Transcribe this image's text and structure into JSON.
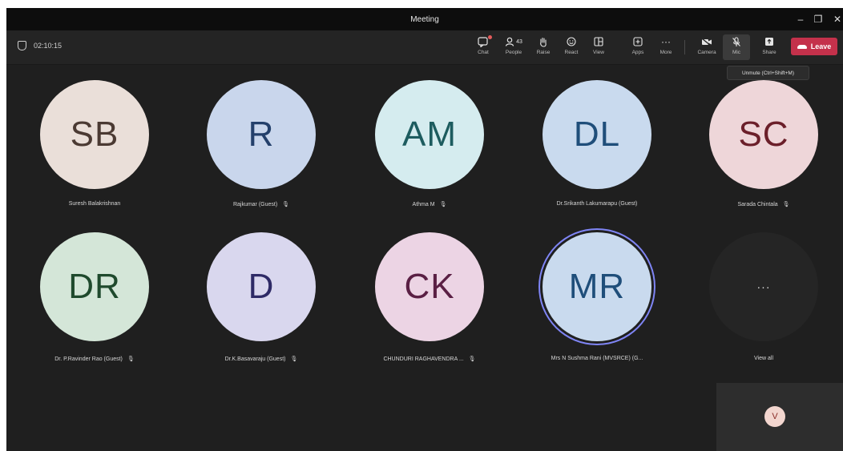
{
  "window": {
    "title": "Meeting",
    "controls": [
      "–",
      "❐",
      "✕"
    ]
  },
  "toolbar": {
    "timer": "02:10:15",
    "buttons": [
      {
        "label": "Chat",
        "icon": "chat-icon"
      },
      {
        "label": "People",
        "icon": "people-icon",
        "count": "43"
      },
      {
        "label": "Raise",
        "icon": "raise-hand-icon"
      },
      {
        "label": "React",
        "icon": "react-icon"
      },
      {
        "label": "View",
        "icon": "view-icon"
      },
      {
        "label": "Apps",
        "icon": "apps-icon"
      },
      {
        "label": "More",
        "icon": "more-icon"
      },
      {
        "label": "Camera",
        "icon": "camera-off-icon"
      },
      {
        "label": "Mic",
        "icon": "mic-off-icon"
      },
      {
        "label": "Share",
        "icon": "share-icon"
      }
    ],
    "leave_label": "Leave",
    "tooltip": "Unmute (Ctrl+Shift+M)"
  },
  "participants": [
    {
      "initials": "SB",
      "name": "Suresh Balakrishnan",
      "muted": false,
      "bg": "#eadfd9",
      "fg": "#4b3a33"
    },
    {
      "initials": "R",
      "name": "Rajkumar (Guest)",
      "muted": true,
      "bg": "#c9d6ec",
      "fg": "#24406b"
    },
    {
      "initials": "AM",
      "name": "Athma M",
      "muted": true,
      "bg": "#d5ecef",
      "fg": "#1d5c5f"
    },
    {
      "initials": "DL",
      "name": "Dr.Srikanth Lakumarapu (Guest)",
      "muted": false,
      "bg": "#c9daee",
      "fg": "#1f4e7a"
    },
    {
      "initials": "SC",
      "name": "Sarada Chintala",
      "muted": true,
      "bg": "#eed6d9",
      "fg": "#6b1f2a"
    },
    {
      "initials": "DR",
      "name": "Dr. P.Ravinder Rao (Guest)",
      "muted": true,
      "bg": "#d4e6d8",
      "fg": "#1f4a2d"
    },
    {
      "initials": "D",
      "name": "Dr.K.Basavaraju (Guest)",
      "muted": true,
      "bg": "#d9d7ee",
      "fg": "#2e2a66"
    },
    {
      "initials": "CK",
      "name": "CHUNDURI RAGHAVENDRA ...",
      "muted": true,
      "bg": "#ecd4e4",
      "fg": "#5a1f44"
    },
    {
      "initials": "MR",
      "name": "Mrs N Sushma Rani (MVSRCE) (G...",
      "muted": false,
      "bg": "#c9daee",
      "fg": "#1f4e7a",
      "speaking": true
    }
  ],
  "view_all": {
    "label": "View all",
    "dots": "···"
  },
  "self_view": {
    "initials": "V"
  }
}
